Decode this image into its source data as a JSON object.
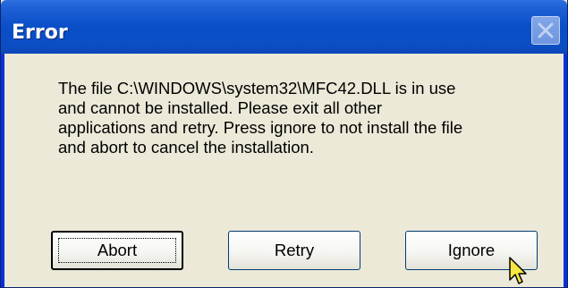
{
  "dialog": {
    "title": "Error",
    "message": "The file C:\\WINDOWS\\system32\\MFC42.DLL is in use\nand cannot be installed.  Please exit all other\napplications and retry.  Press ignore to not install the file\nand abort to cancel the installation.",
    "buttons": {
      "abort": "Abort",
      "retry": "Retry",
      "ignore": "Ignore"
    }
  },
  "icons": {
    "close": "close-icon",
    "cursor": "mouse-pointer-icon"
  },
  "colors": {
    "titlebar": "#0a4fc8",
    "body": "#ece9d8",
    "title_text": "#ffffff"
  }
}
